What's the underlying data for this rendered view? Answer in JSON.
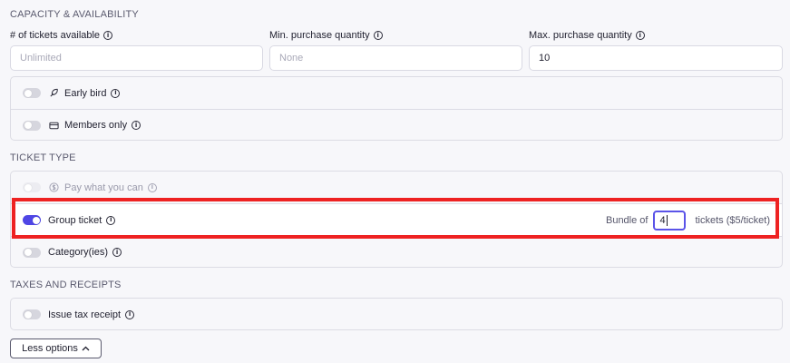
{
  "capacity": {
    "section_title": "CAPACITY & AVAILABILITY",
    "tickets_available": {
      "label": "# of tickets available",
      "placeholder": "Unlimited",
      "value": ""
    },
    "min_purchase": {
      "label": "Min. purchase quantity",
      "placeholder": "None",
      "value": ""
    },
    "max_purchase": {
      "label": "Max. purchase quantity",
      "value": "10"
    },
    "options": [
      {
        "label": "Early bird",
        "enabled": false,
        "icon": "bird-icon"
      },
      {
        "label": "Members only",
        "enabled": false,
        "icon": "card-icon"
      }
    ]
  },
  "ticket_type": {
    "section_title": "TICKET TYPE",
    "options": [
      {
        "label": "Pay what you can",
        "enabled": false,
        "disabled": true,
        "icon": "dollar-circle-icon"
      },
      {
        "label": "Group ticket",
        "enabled": true
      },
      {
        "label": "Category(ies)",
        "enabled": false
      }
    ],
    "bundle": {
      "prefix": "Bundle of",
      "value": "4",
      "suffix": "tickets ($5/ticket)"
    }
  },
  "taxes": {
    "section_title": "TAXES AND RECEIPTS",
    "options": [
      {
        "label": "Issue tax receipt",
        "enabled": false
      }
    ]
  },
  "less_options_label": "Less options",
  "colors": {
    "accent": "#4f46e5",
    "highlight_border": "#ee2222"
  }
}
